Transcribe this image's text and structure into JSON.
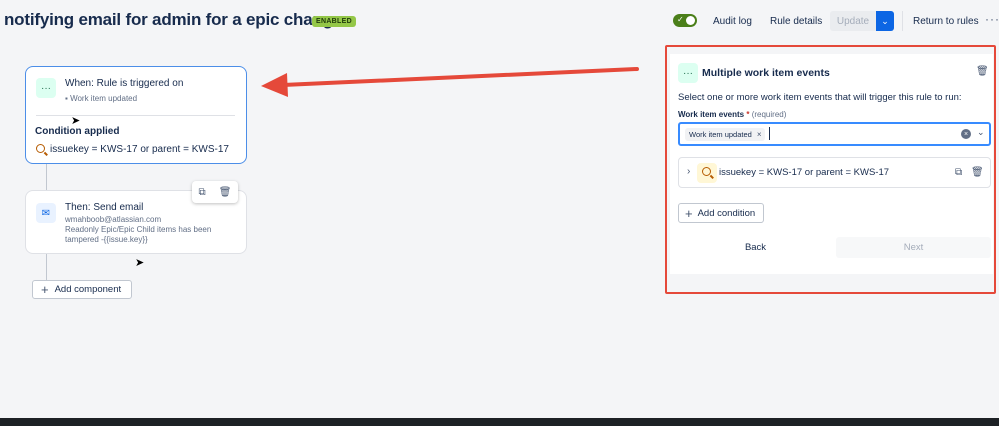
{
  "header": {
    "title": "notifying email for admin for a epic change",
    "status_badge": "ENABLED",
    "audit_log": "Audit log",
    "rule_details": "Rule details",
    "update": "Update",
    "return_to_rules": "Return to rules",
    "more": "···"
  },
  "trigger": {
    "title": "When: Rule is triggered on",
    "event": "Work item updated",
    "condition_label": "Condition applied",
    "condition": "issuekey = KWS-17 or parent = KWS-17"
  },
  "action": {
    "title": "Then: Send email",
    "recipient": "wmahboob@atlassian.com",
    "body_line1": "Readonly Epic/Epic Child items has been",
    "body_line2": "tampered -{{issue.key}}"
  },
  "add_component": "Add component",
  "panel": {
    "title": "Multiple work item events",
    "description": "Select one or more work item events that will trigger this rule to run:",
    "field_label": "Work item events",
    "required_mark": "*",
    "required_text": "(required)",
    "selected_chip": "Work item updated",
    "condition": "issuekey = KWS-17 or parent = KWS-17",
    "add_condition": "Add condition",
    "back": "Back",
    "next": "Next"
  },
  "colors": {
    "accent": "#0c66e4",
    "annotation_red": "#e5493a",
    "enabled_green": "#94c748",
    "toggle_green": "#4b7f1a"
  }
}
